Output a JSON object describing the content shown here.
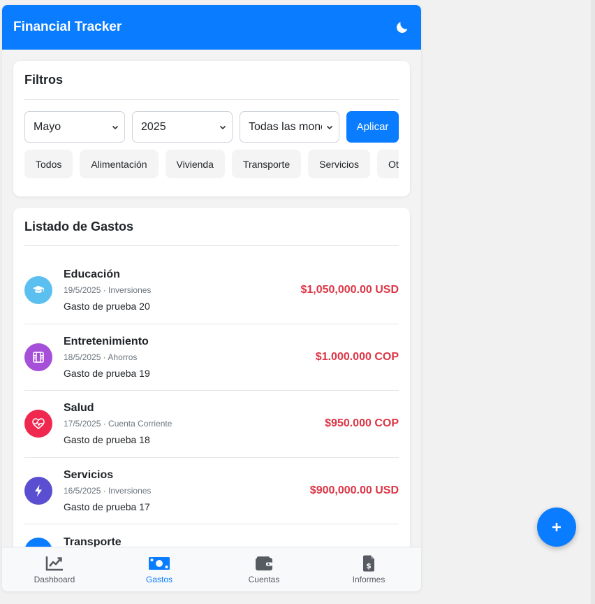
{
  "header": {
    "title": "Financial Tracker"
  },
  "filters": {
    "title": "Filtros",
    "month": "Mayo",
    "year": "2025",
    "currency": "Todas las monedas",
    "apply_label": "Aplicar",
    "categories": [
      "Todos",
      "Alimentación",
      "Vivienda",
      "Transporte",
      "Servicios",
      "Otros"
    ]
  },
  "expenses": {
    "title": "Listado de Gastos",
    "items": [
      {
        "category": "Educación",
        "meta": "19/5/2025 · Inversiones",
        "description": "Gasto de prueba 20",
        "amount": "$1,050,000.00 USD",
        "color": "#5bc0f0",
        "icon": "graduation-cap-icon"
      },
      {
        "category": "Entretenimiento",
        "meta": "18/5/2025 · Ahorros",
        "description": "Gasto de prueba 19",
        "amount": "$1.000.000 COP",
        "color": "#a64fd9",
        "icon": "film-icon"
      },
      {
        "category": "Salud",
        "meta": "17/5/2025 · Cuenta Corriente",
        "description": "Gasto de prueba 18",
        "amount": "$950.000 COP",
        "color": "#f0284f",
        "icon": "heart-pulse-icon"
      },
      {
        "category": "Servicios",
        "meta": "16/5/2025 · Inversiones",
        "description": "Gasto de prueba 17",
        "amount": "$900,000.00 USD",
        "color": "#5a4fd0",
        "icon": "bolt-icon"
      },
      {
        "category": "Transporte",
        "meta": "",
        "description": "",
        "amount": "",
        "color": "#0a7cff",
        "icon": "car-icon"
      }
    ]
  },
  "nav": {
    "dashboard": "Dashboard",
    "gastos": "Gastos",
    "cuentas": "Cuentas",
    "informes": "Informes"
  },
  "fab": {
    "label": "+"
  },
  "colors": {
    "primary": "#0a7cff",
    "expense": "#dc3545"
  }
}
